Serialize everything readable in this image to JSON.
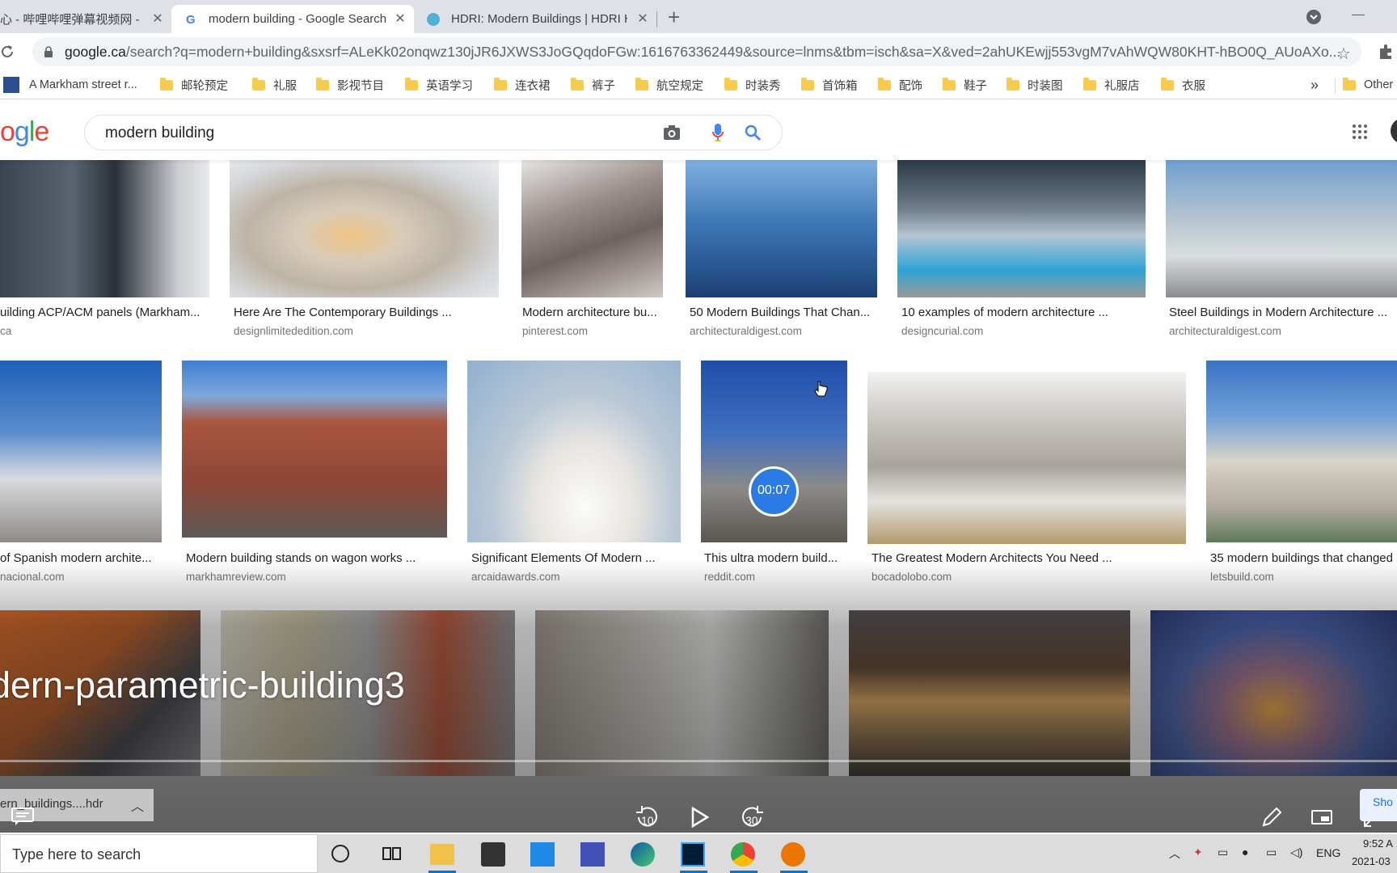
{
  "browser": {
    "tabs": [
      {
        "title": "心 - 哔哩哔哩弹幕视频网 -",
        "active": false
      },
      {
        "title": "modern building - Google Search",
        "active": true
      },
      {
        "title": "HDRI: Modern Buildings | HDRI H",
        "active": false
      }
    ],
    "new_tab_symbol": "+",
    "url_host": "google.ca",
    "url_rest": "/search?q=modern+building&sxsrf=ALeKk02onqwz130jJR6JXWS3JoGQqdoFGw:1616763362449&source=lnms&tbm=isch&sa=X&ved=2ahUKEwjj553vgM7vAhWQW80KHT-hBO0Q_AUoAXo...",
    "bookmarks": [
      "A Markham street r...",
      "邮轮预定",
      "礼服",
      "影视节目",
      "英语学习",
      "连衣裙",
      "裤子",
      "航空规定",
      "时装秀",
      "首饰箱",
      "配饰",
      "鞋子",
      "时装图",
      "礼服店",
      "衣服"
    ],
    "bookmarks_overflow": "»",
    "other_bookmarks": "Other"
  },
  "google": {
    "logo_letters": [
      "o",
      "g",
      "l",
      "e"
    ],
    "logo_colors": [
      "#ea4335",
      "#4285f4",
      "#34a853",
      "#ea4335"
    ],
    "query": "modern building"
  },
  "results": {
    "row1": [
      {
        "caption": "uilding ACP/ACM panels (Markham...",
        "source": "ca"
      },
      {
        "caption": "Here Are The Contemporary Buildings ...",
        "source": "designlimitededition.com"
      },
      {
        "caption": "Modern architecture bu...",
        "source": "pinterest.com"
      },
      {
        "caption": "50 Modern Buildings That Chan...",
        "source": "architecturaldigest.com"
      },
      {
        "caption": "10 examples of modern architecture ...",
        "source": "designcurial.com"
      },
      {
        "caption": "Steel Buildings in Modern Architecture ...",
        "source": "architecturaldigest.com"
      }
    ],
    "row2": [
      {
        "caption": "of Spanish modern archite...",
        "source": "nacional.com"
      },
      {
        "caption": "Modern building stands on wagon works ...",
        "source": "markhamreview.com"
      },
      {
        "caption": "Significant Elements Of Modern ...",
        "source": "arcaidawards.com"
      },
      {
        "caption": "This ultra modern build...",
        "source": "reddit.com"
      },
      {
        "caption": "The Greatest Modern Architects You Need ...",
        "source": "bocadolobo.com"
      },
      {
        "caption": "35 modern buildings that changed",
        "source": "letsbuild.com"
      }
    ],
    "video_badge": "00:07"
  },
  "player": {
    "title": "dern-parametric-building3",
    "download_chip": "ern_buildings....hdr",
    "rewind_label": "10",
    "forward_label": "30",
    "partial_label": "Sho"
  },
  "taskbar": {
    "search_placeholder": "Type here to search",
    "lang": "ENG",
    "time": "9:52 A",
    "date": "2021-03"
  }
}
